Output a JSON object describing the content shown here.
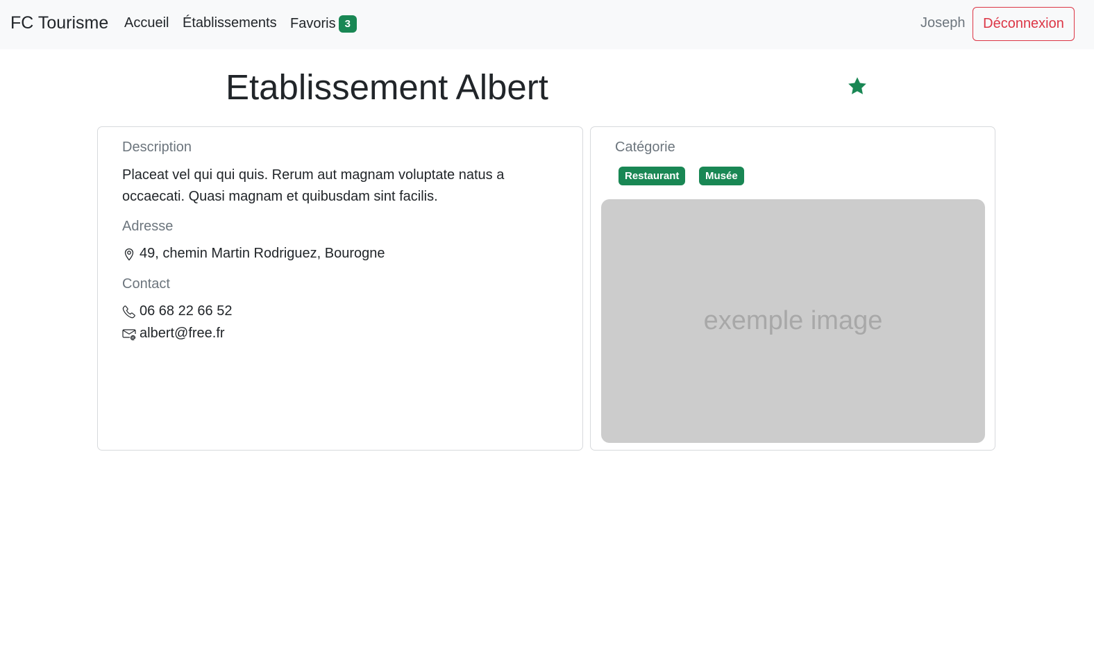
{
  "navbar": {
    "brand": "FC Tourisme",
    "links": [
      "Accueil",
      "Établissements",
      "Favoris"
    ],
    "favorites_count": "3",
    "user_name": "Joseph",
    "logout_label": "Déconnexion"
  },
  "establishment": {
    "title": "Etablissement Albert",
    "is_favorite": true,
    "favorite_icon": "star-filled-icon",
    "description_label": "Description",
    "description": "Placeat vel qui qui quis. Rerum aut magnam voluptate natus a occaecati. Quasi magnam et quibusdam sint facilis.",
    "address_label": "Adresse",
    "address": "49, chemin Martin Rodriguez, Bourogne",
    "contact_label": "Contact",
    "phone": "06 68 22 66 52",
    "email": "albert@free.fr",
    "category_label": "Catégorie",
    "categories": [
      "Restaurant",
      "Musée"
    ],
    "image_placeholder": "exemple image"
  },
  "colors": {
    "accent": "#198754",
    "danger": "#dc3545",
    "muted": "#6c757d",
    "navbar_bg": "#f8f9fa",
    "placeholder_bg": "#cccccc"
  }
}
